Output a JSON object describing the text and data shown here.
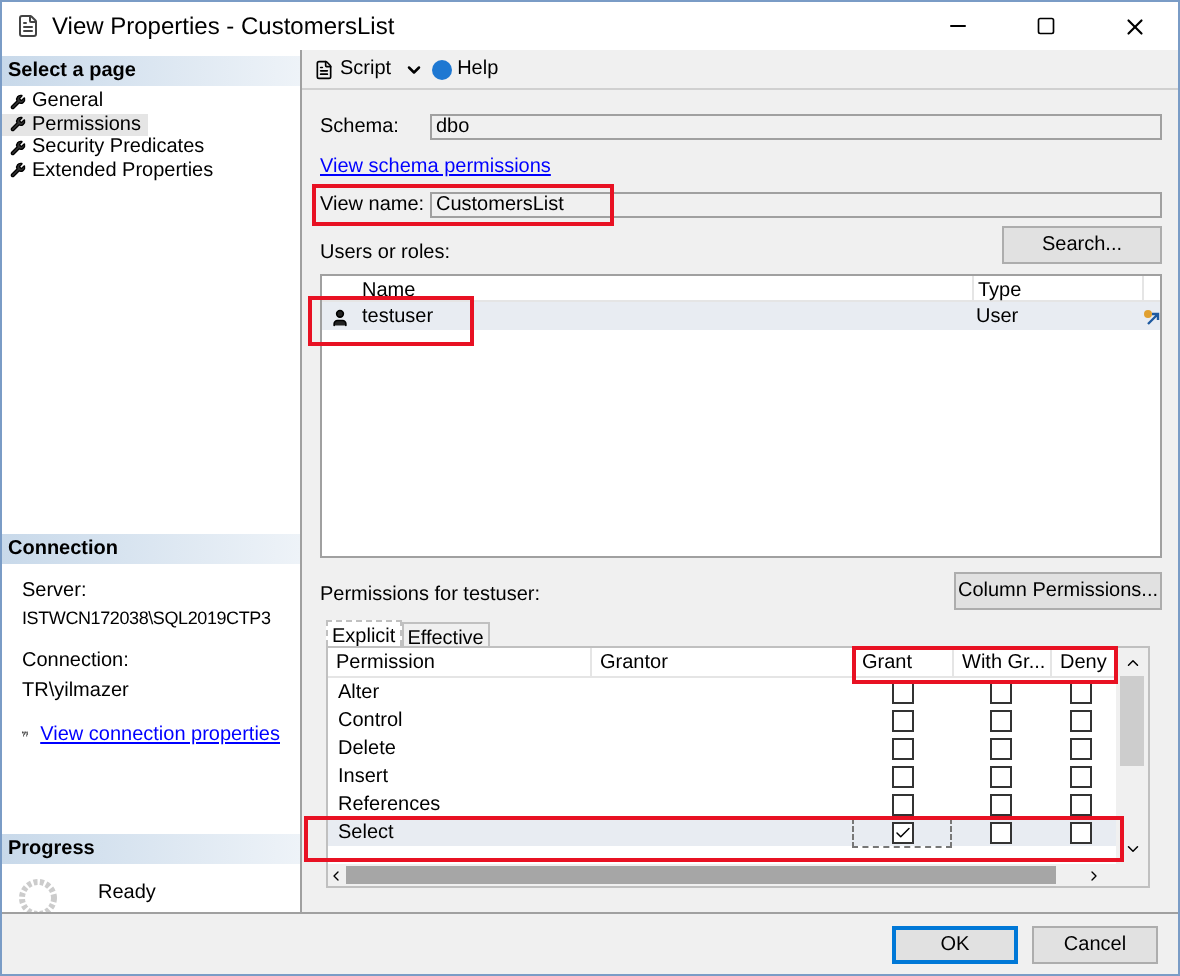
{
  "window": {
    "title": "View Properties - CustomersList"
  },
  "sidebar": {
    "header": "Select a page",
    "items": [
      {
        "label": "General",
        "selected": false
      },
      {
        "label": "Permissions",
        "selected": true
      },
      {
        "label": "Security Predicates",
        "selected": false
      },
      {
        "label": "Extended Properties",
        "selected": false
      }
    ]
  },
  "connection": {
    "header": "Connection",
    "server_label": "Server:",
    "server": "ISTWCN172038\\SQL2019CTP3",
    "connection_label": "Connection:",
    "connection": "TR\\yilmazer",
    "link": "View connection properties"
  },
  "progress": {
    "header": "Progress",
    "status": "Ready"
  },
  "toolbar": {
    "script": "Script",
    "help": "Help"
  },
  "form": {
    "schema_label": "Schema:",
    "schema": "dbo",
    "schema_link": "View schema permissions",
    "view_name_label": "View name:",
    "view_name": "CustomersList",
    "users_label": "Users or roles:",
    "search_button": "Search..."
  },
  "users_table": {
    "columns": [
      "Name",
      "Type"
    ],
    "rows": [
      {
        "name": "testuser",
        "type": "User",
        "selected": true
      }
    ]
  },
  "permissions": {
    "label": "Permissions for testuser:",
    "column_button": "Column Permissions...",
    "tabs": [
      {
        "label": "Explicit",
        "selected": true
      },
      {
        "label": "Effective",
        "selected": false
      }
    ],
    "columns": [
      "Permission",
      "Grantor",
      "Grant",
      "With Gr...",
      "Deny"
    ],
    "rows": [
      {
        "permission": "Alter",
        "grant": false,
        "with_grant": false,
        "deny": false,
        "selected": false
      },
      {
        "permission": "Control",
        "grant": false,
        "with_grant": false,
        "deny": false,
        "selected": false
      },
      {
        "permission": "Delete",
        "grant": false,
        "with_grant": false,
        "deny": false,
        "selected": false
      },
      {
        "permission": "Insert",
        "grant": false,
        "with_grant": false,
        "deny": false,
        "selected": false
      },
      {
        "permission": "References",
        "grant": false,
        "with_grant": false,
        "deny": false,
        "selected": false
      },
      {
        "permission": "Select",
        "grant": true,
        "with_grant": false,
        "deny": false,
        "selected": true
      }
    ]
  },
  "buttons": [
    "OK",
    "Cancel"
  ]
}
